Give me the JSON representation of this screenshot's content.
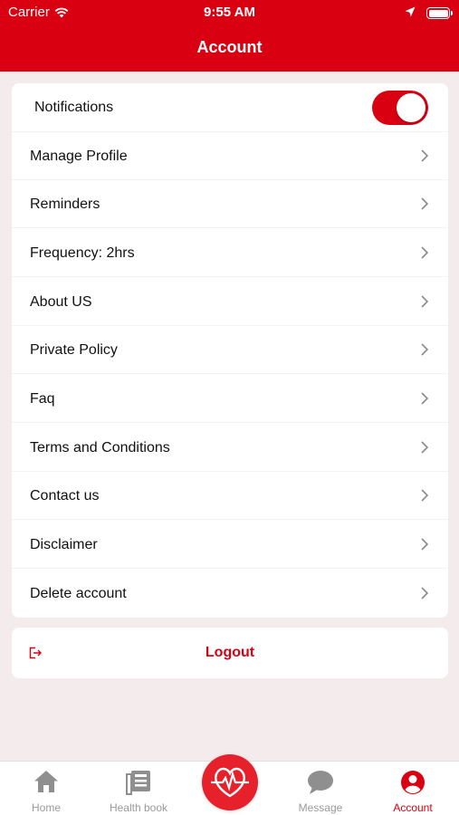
{
  "status_bar": {
    "carrier": "Carrier",
    "time": "9:55 AM",
    "icons": [
      "wifi-icon",
      "location-arrow-icon",
      "battery-icon"
    ]
  },
  "header": {
    "title": "Account"
  },
  "notifications": {
    "label": "Notifications",
    "enabled": true
  },
  "menu": {
    "items": [
      {
        "label": "Manage Profile"
      },
      {
        "label": "Reminders"
      },
      {
        "label": "Frequency: 2hrs"
      },
      {
        "label": "About US"
      },
      {
        "label": "Private Policy"
      },
      {
        "label": "Faq"
      },
      {
        "label": "Terms and Conditions"
      },
      {
        "label": "Contact us"
      },
      {
        "label": "Disclaimer"
      },
      {
        "label": "Delete account"
      }
    ]
  },
  "logout": {
    "label": "Logout",
    "icon": "logout-icon"
  },
  "tabbar": {
    "tabs": [
      {
        "label": "Home",
        "icon": "home-icon"
      },
      {
        "label": "Health book",
        "icon": "health-book-icon"
      },
      {
        "label": "",
        "icon": "heartbeat-icon"
      },
      {
        "label": "Message",
        "icon": "message-bubble-icon"
      },
      {
        "label": "Account",
        "icon": "account-user-icon",
        "active": true
      }
    ]
  },
  "colors": {
    "brand": "#d90012",
    "background": "#f4ecec",
    "inactive_tab": "#9a9a9a"
  }
}
